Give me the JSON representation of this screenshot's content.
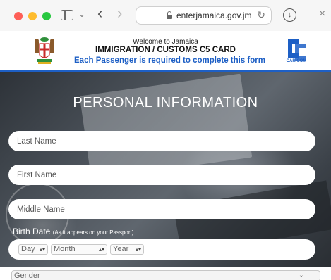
{
  "browser": {
    "url": "enterjamaica.gov.jm",
    "back_icon": "‹",
    "forward_icon": "›",
    "reload_icon": "↻",
    "download_icon": "↓",
    "close_icon": "×",
    "chevron_icon": "⌄"
  },
  "header": {
    "welcome": "Welcome to Jamaica",
    "title": "IMMIGRATION / CUSTOMS C5 CARD",
    "subtitle": "Each Passenger is required to complete this form",
    "caricom_label": "CARICOM",
    "accent_color": "#1d5fc5"
  },
  "form": {
    "section_title": "PERSONAL INFORMATION",
    "last_name_placeholder": "Last Name",
    "first_name_placeholder": "First Name",
    "middle_name_placeholder": "Middle Name",
    "birth_label": "Birth Date",
    "birth_note": "(As it appears on your Passport)",
    "day": "Day",
    "month": "Month",
    "year": "Year",
    "gender": "Gender"
  }
}
